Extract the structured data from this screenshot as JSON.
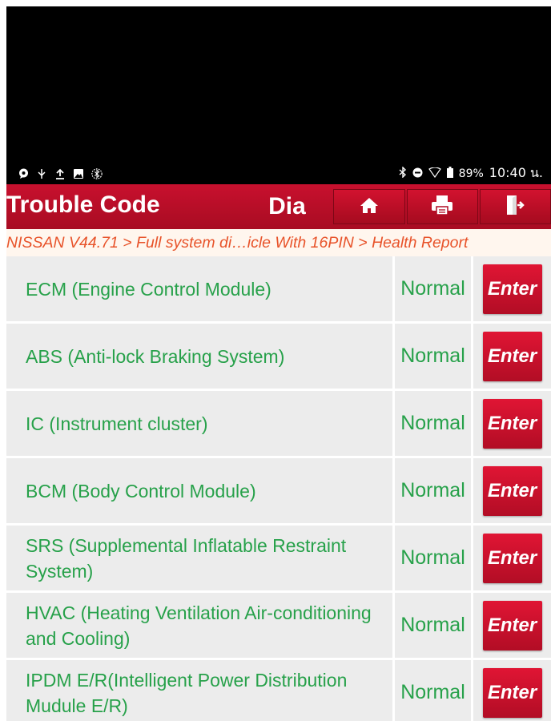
{
  "status_bar": {
    "battery_percent": "89%",
    "time": "10:40 น.",
    "left_icons": [
      "chat-bubble-icon",
      "usb-icon",
      "upload-icon",
      "image-icon",
      "bluetooth-off-icon"
    ],
    "right_icons": [
      "bluetooth-icon",
      "do-not-disturb-icon",
      "wifi-icon",
      "battery-icon"
    ]
  },
  "titlebar": {
    "title": "Trouble Code",
    "title_fragment": "Dia",
    "buttons": [
      "home-icon",
      "print-icon",
      "exit-icon"
    ]
  },
  "breadcrumb": "NISSAN V44.71 > Full system di…icle With 16PIN > Health Report",
  "colors": {
    "accent_red": "#c8102e",
    "status_green": "#27a14a",
    "breadcrumb_orange": "#e8532a"
  },
  "systems": [
    {
      "name": "ECM (Engine Control Module)",
      "status": "Normal",
      "action": "Enter"
    },
    {
      "name": "ABS (Anti-lock Braking System)",
      "status": "Normal",
      "action": "Enter"
    },
    {
      "name": "IC (Instrument cluster)",
      "status": "Normal",
      "action": "Enter"
    },
    {
      "name": "BCM (Body Control Module)",
      "status": "Normal",
      "action": "Enter"
    },
    {
      "name": "SRS (Supplemental Inflatable Restraint System)",
      "status": "Normal",
      "action": "Enter"
    },
    {
      "name": "HVAC (Heating Ventilation Air-conditioning and Cooling)",
      "status": "Normal",
      "action": "Enter"
    },
    {
      "name": "IPDM E/R(Intelligent Power Distribution Mudule E/R)",
      "status": "Normal",
      "action": "Enter"
    }
  ]
}
